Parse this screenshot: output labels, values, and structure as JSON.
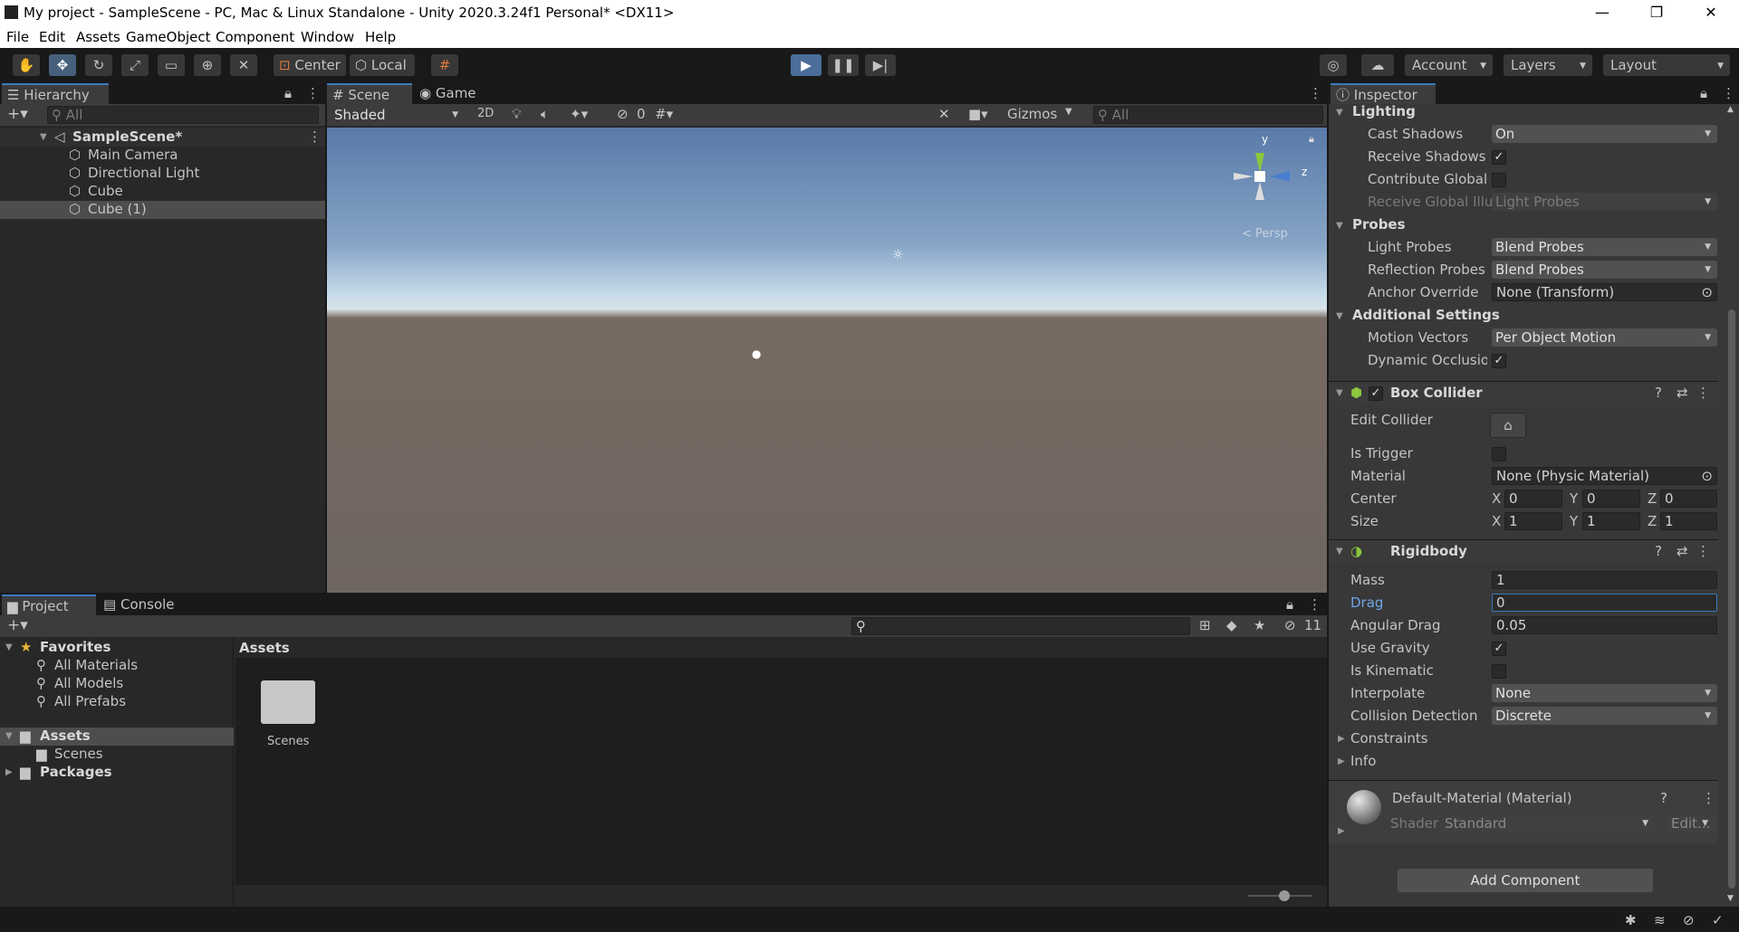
{
  "window": {
    "title": "My project - SampleScene - PC, Mac & Linux Standalone - Unity 2020.3.24f1 Personal* <DX11>",
    "minimize": "—",
    "maximize": "❐",
    "close": "✕"
  },
  "menu": [
    "File",
    "Edit",
    "Assets",
    "GameObject",
    "Component",
    "Window",
    "Help"
  ],
  "toolbar": {
    "center_label": "Center",
    "local_label": "Local",
    "account_label": "Account",
    "layers_label": "Layers",
    "layout_label": "Layout"
  },
  "hierarchy": {
    "tab": "Hierarchy",
    "search_placeholder": "All",
    "scene": "SampleScene*",
    "items": [
      "Main Camera",
      "Directional Light",
      "Cube",
      "Cube (1)"
    ]
  },
  "scene_view": {
    "tab_scene": "Scene",
    "tab_game": "Game",
    "shading": "Shaded",
    "mode_2d": "2D",
    "hidden_count": "0",
    "gizmos": "Gizmos",
    "search_placeholder": "All",
    "persp_label": "< Persp",
    "axis_y": "y",
    "axis_z": "z"
  },
  "project": {
    "tab_project": "Project",
    "tab_console": "Console",
    "favorites": "Favorites",
    "fav_items": [
      "All Materials",
      "All Models",
      "All Prefabs"
    ],
    "assets": "Assets",
    "scenes": "Scenes",
    "packages": "Packages",
    "breadcrumb": "Assets",
    "folder_name": "Scenes",
    "hidden_count": "11"
  },
  "inspector": {
    "tab": "Inspector",
    "lighting": {
      "header": "Lighting",
      "cast_shadows_label": "Cast Shadows",
      "cast_shadows_value": "On",
      "receive_shadows_label": "Receive Shadows",
      "contribute_gi_label": "Contribute Global I",
      "receive_gi_label": "Receive Global Illu",
      "receive_gi_value": "Light Probes"
    },
    "probes": {
      "header": "Probes",
      "light_probes_label": "Light Probes",
      "light_probes_value": "Blend Probes",
      "reflection_probes_label": "Reflection Probes",
      "reflection_probes_value": "Blend Probes",
      "anchor_label": "Anchor Override",
      "anchor_value": "None (Transform)"
    },
    "additional": {
      "header": "Additional Settings",
      "motion_vectors_label": "Motion Vectors",
      "motion_vectors_value": "Per Object Motion",
      "dynamic_occlusion_label": "Dynamic Occlusion"
    },
    "box_collider": {
      "header": "Box Collider",
      "edit_collider_label": "Edit Collider",
      "is_trigger_label": "Is Trigger",
      "material_label": "Material",
      "material_value": "None (Physic Material)",
      "center_label": "Center",
      "center": {
        "x": "0",
        "y": "0",
        "z": "0"
      },
      "size_label": "Size",
      "size": {
        "x": "1",
        "y": "1",
        "z": "1"
      },
      "x": "X",
      "y": "Y",
      "z": "Z"
    },
    "rigidbody": {
      "header": "Rigidbody",
      "mass_label": "Mass",
      "mass_value": "1",
      "drag_label": "Drag",
      "drag_value": "0",
      "angular_drag_label": "Angular Drag",
      "angular_drag_value": "0.05",
      "use_gravity_label": "Use Gravity",
      "is_kinematic_label": "Is Kinematic",
      "interpolate_label": "Interpolate",
      "interpolate_value": "None",
      "collision_label": "Collision Detection",
      "collision_value": "Discrete",
      "constraints_label": "Constraints",
      "info_label": "Info"
    },
    "material": {
      "name": "Default-Material (Material)",
      "shader_label": "Shader",
      "shader_value": "Standard",
      "edit_label": "Edit..."
    },
    "add_component": "Add Component"
  }
}
